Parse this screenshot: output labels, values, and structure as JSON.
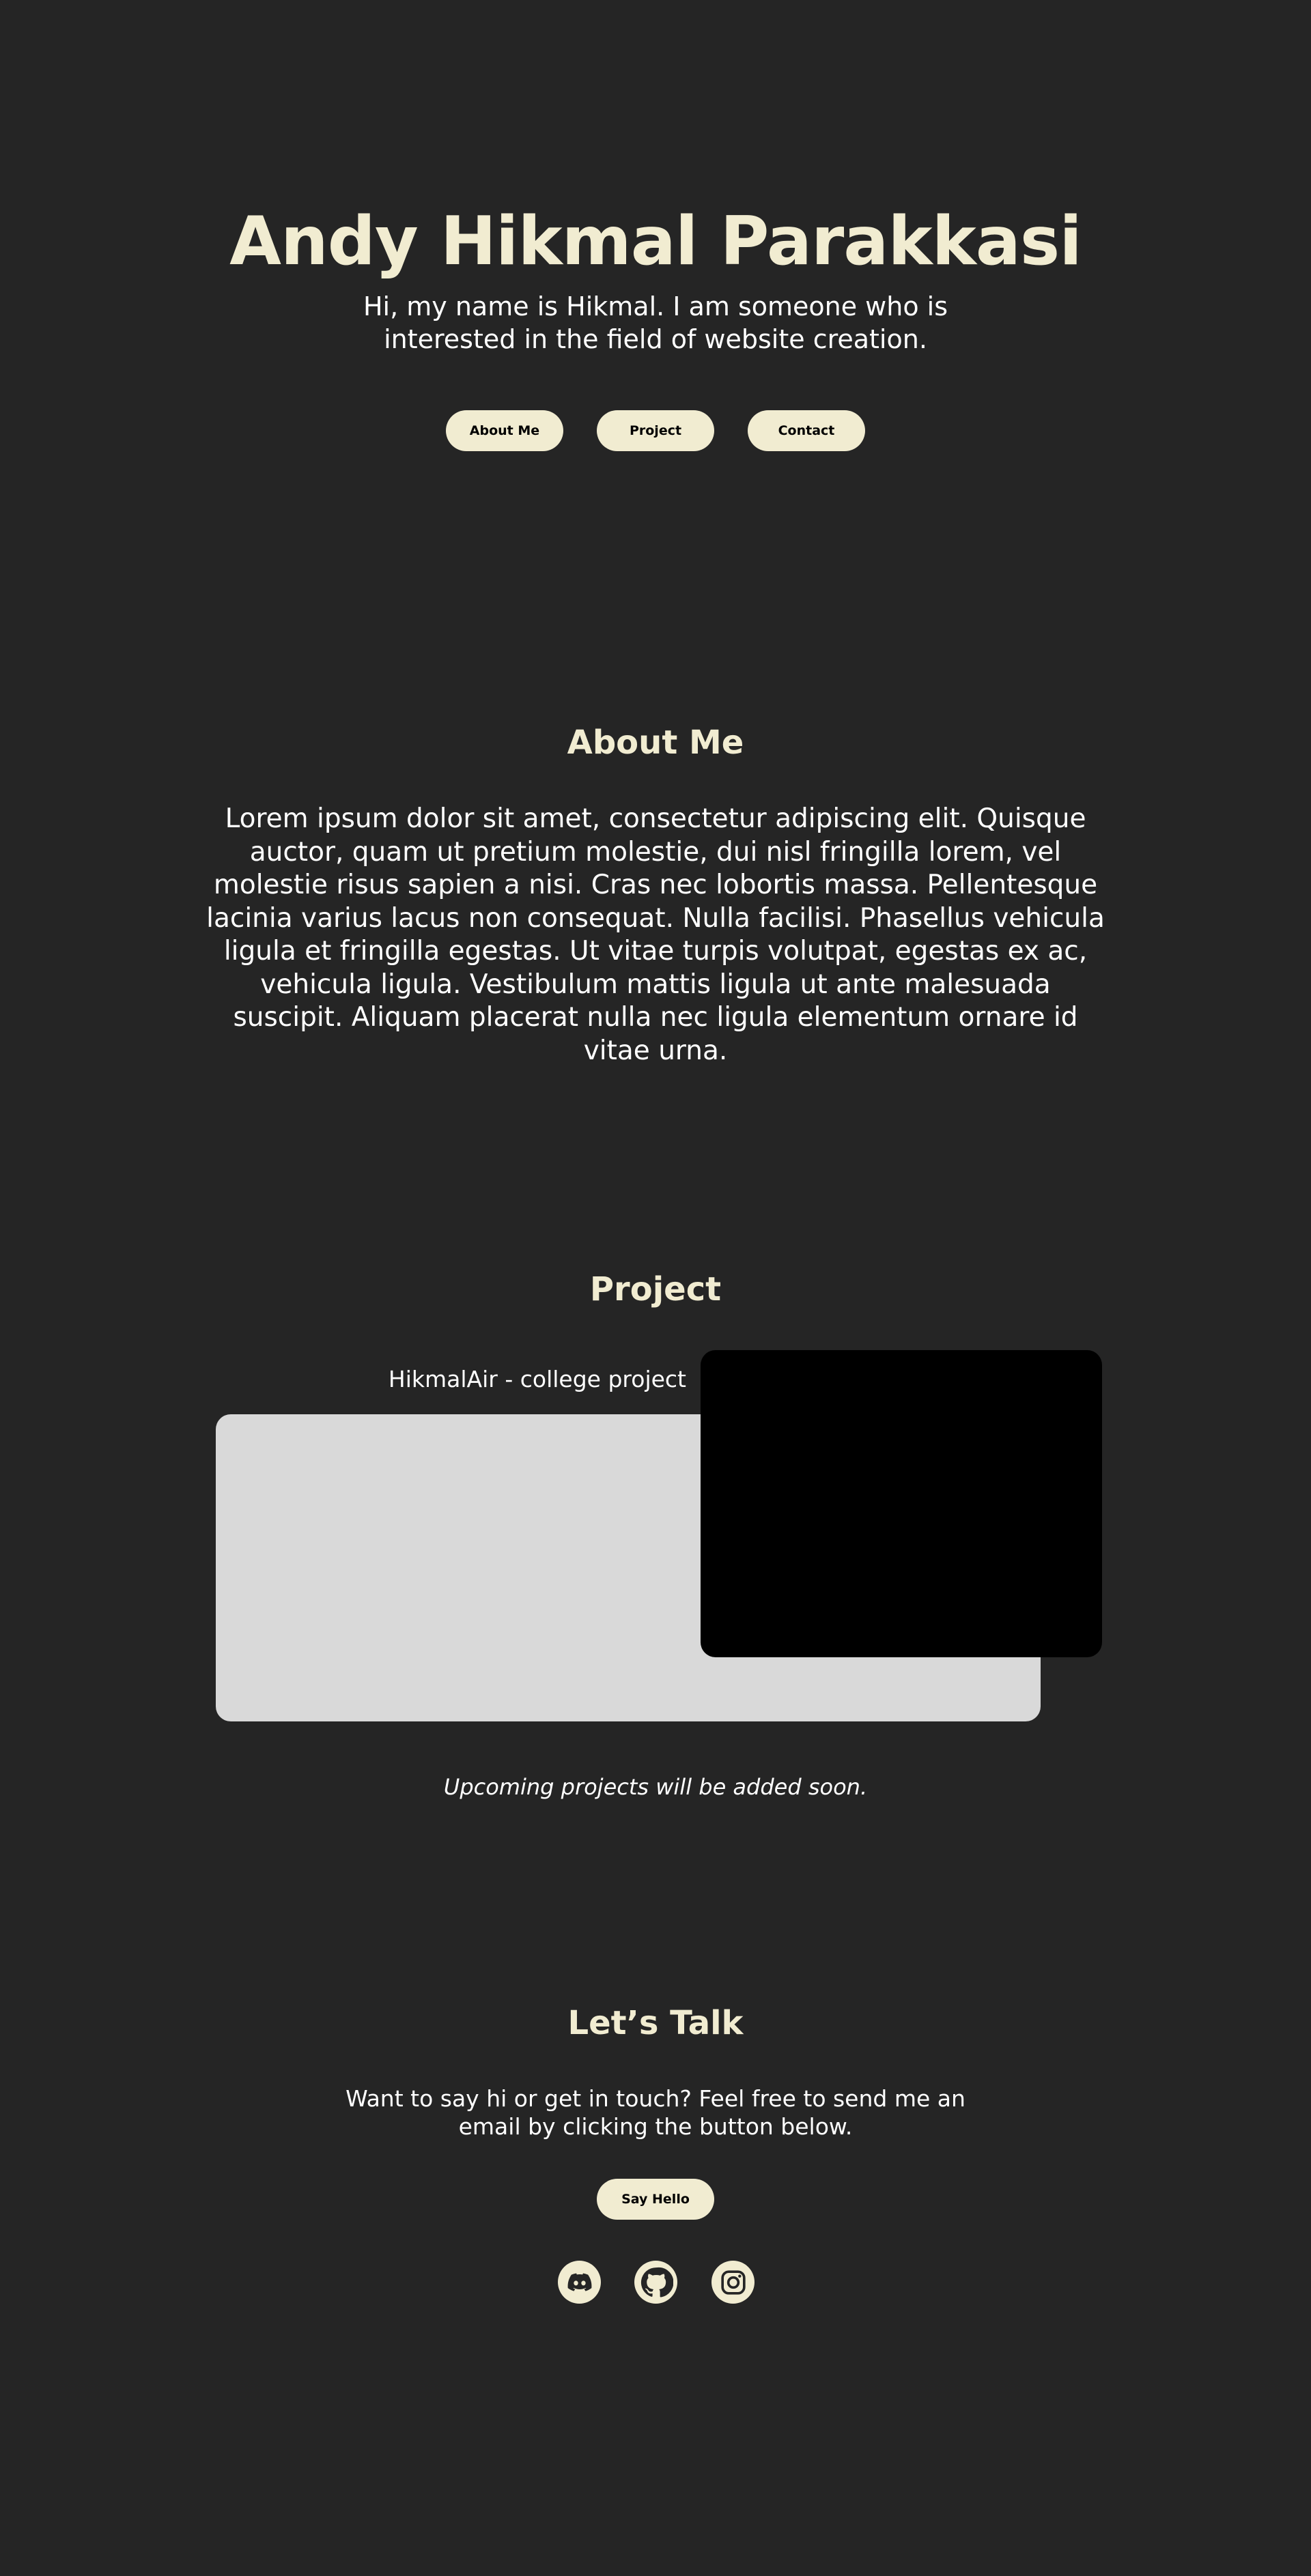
{
  "hero": {
    "title": "Andy Hikmal Parakkasi",
    "subtitle": "Hi, my name is Hikmal. I am someone who is interested in the field of website creation.",
    "buttons": [
      "About Me",
      "Project",
      "Contact"
    ]
  },
  "about": {
    "title": "About Me",
    "body": "Lorem ipsum dolor sit amet, consectetur adipiscing elit. Quisque auctor, quam ut pretium molestie, dui nisl fringilla lorem, vel molestie risus sapien a nisi. Cras nec lobortis massa. Pellentesque lacinia varius lacus non consequat. Nulla facilisi. Phasellus vehicula ligula et fringilla egestas. Ut vitae turpis volutpat, egestas ex ac, vehicula ligula. Vestibulum mattis ligula ut ante malesuada suscipit. Aliquam placerat nulla nec ligula elementum ornare id vitae urna."
  },
  "project": {
    "title": "Project",
    "items": [
      {
        "label": "HikmalAir - college project"
      }
    ],
    "upcoming_note": "Upcoming projects will be added soon."
  },
  "contact": {
    "title": "Let’s Talk",
    "text": "Want to say hi or get in touch? Feel free to send me an email by clicking the button below.",
    "button": "Say Hello",
    "socials": [
      "discord-icon",
      "github-icon",
      "instagram-icon"
    ]
  },
  "colors": {
    "background": "#252525",
    "accent": "#f1ecd1",
    "card_light": "#d9d9d9",
    "card_dark": "#000000"
  }
}
